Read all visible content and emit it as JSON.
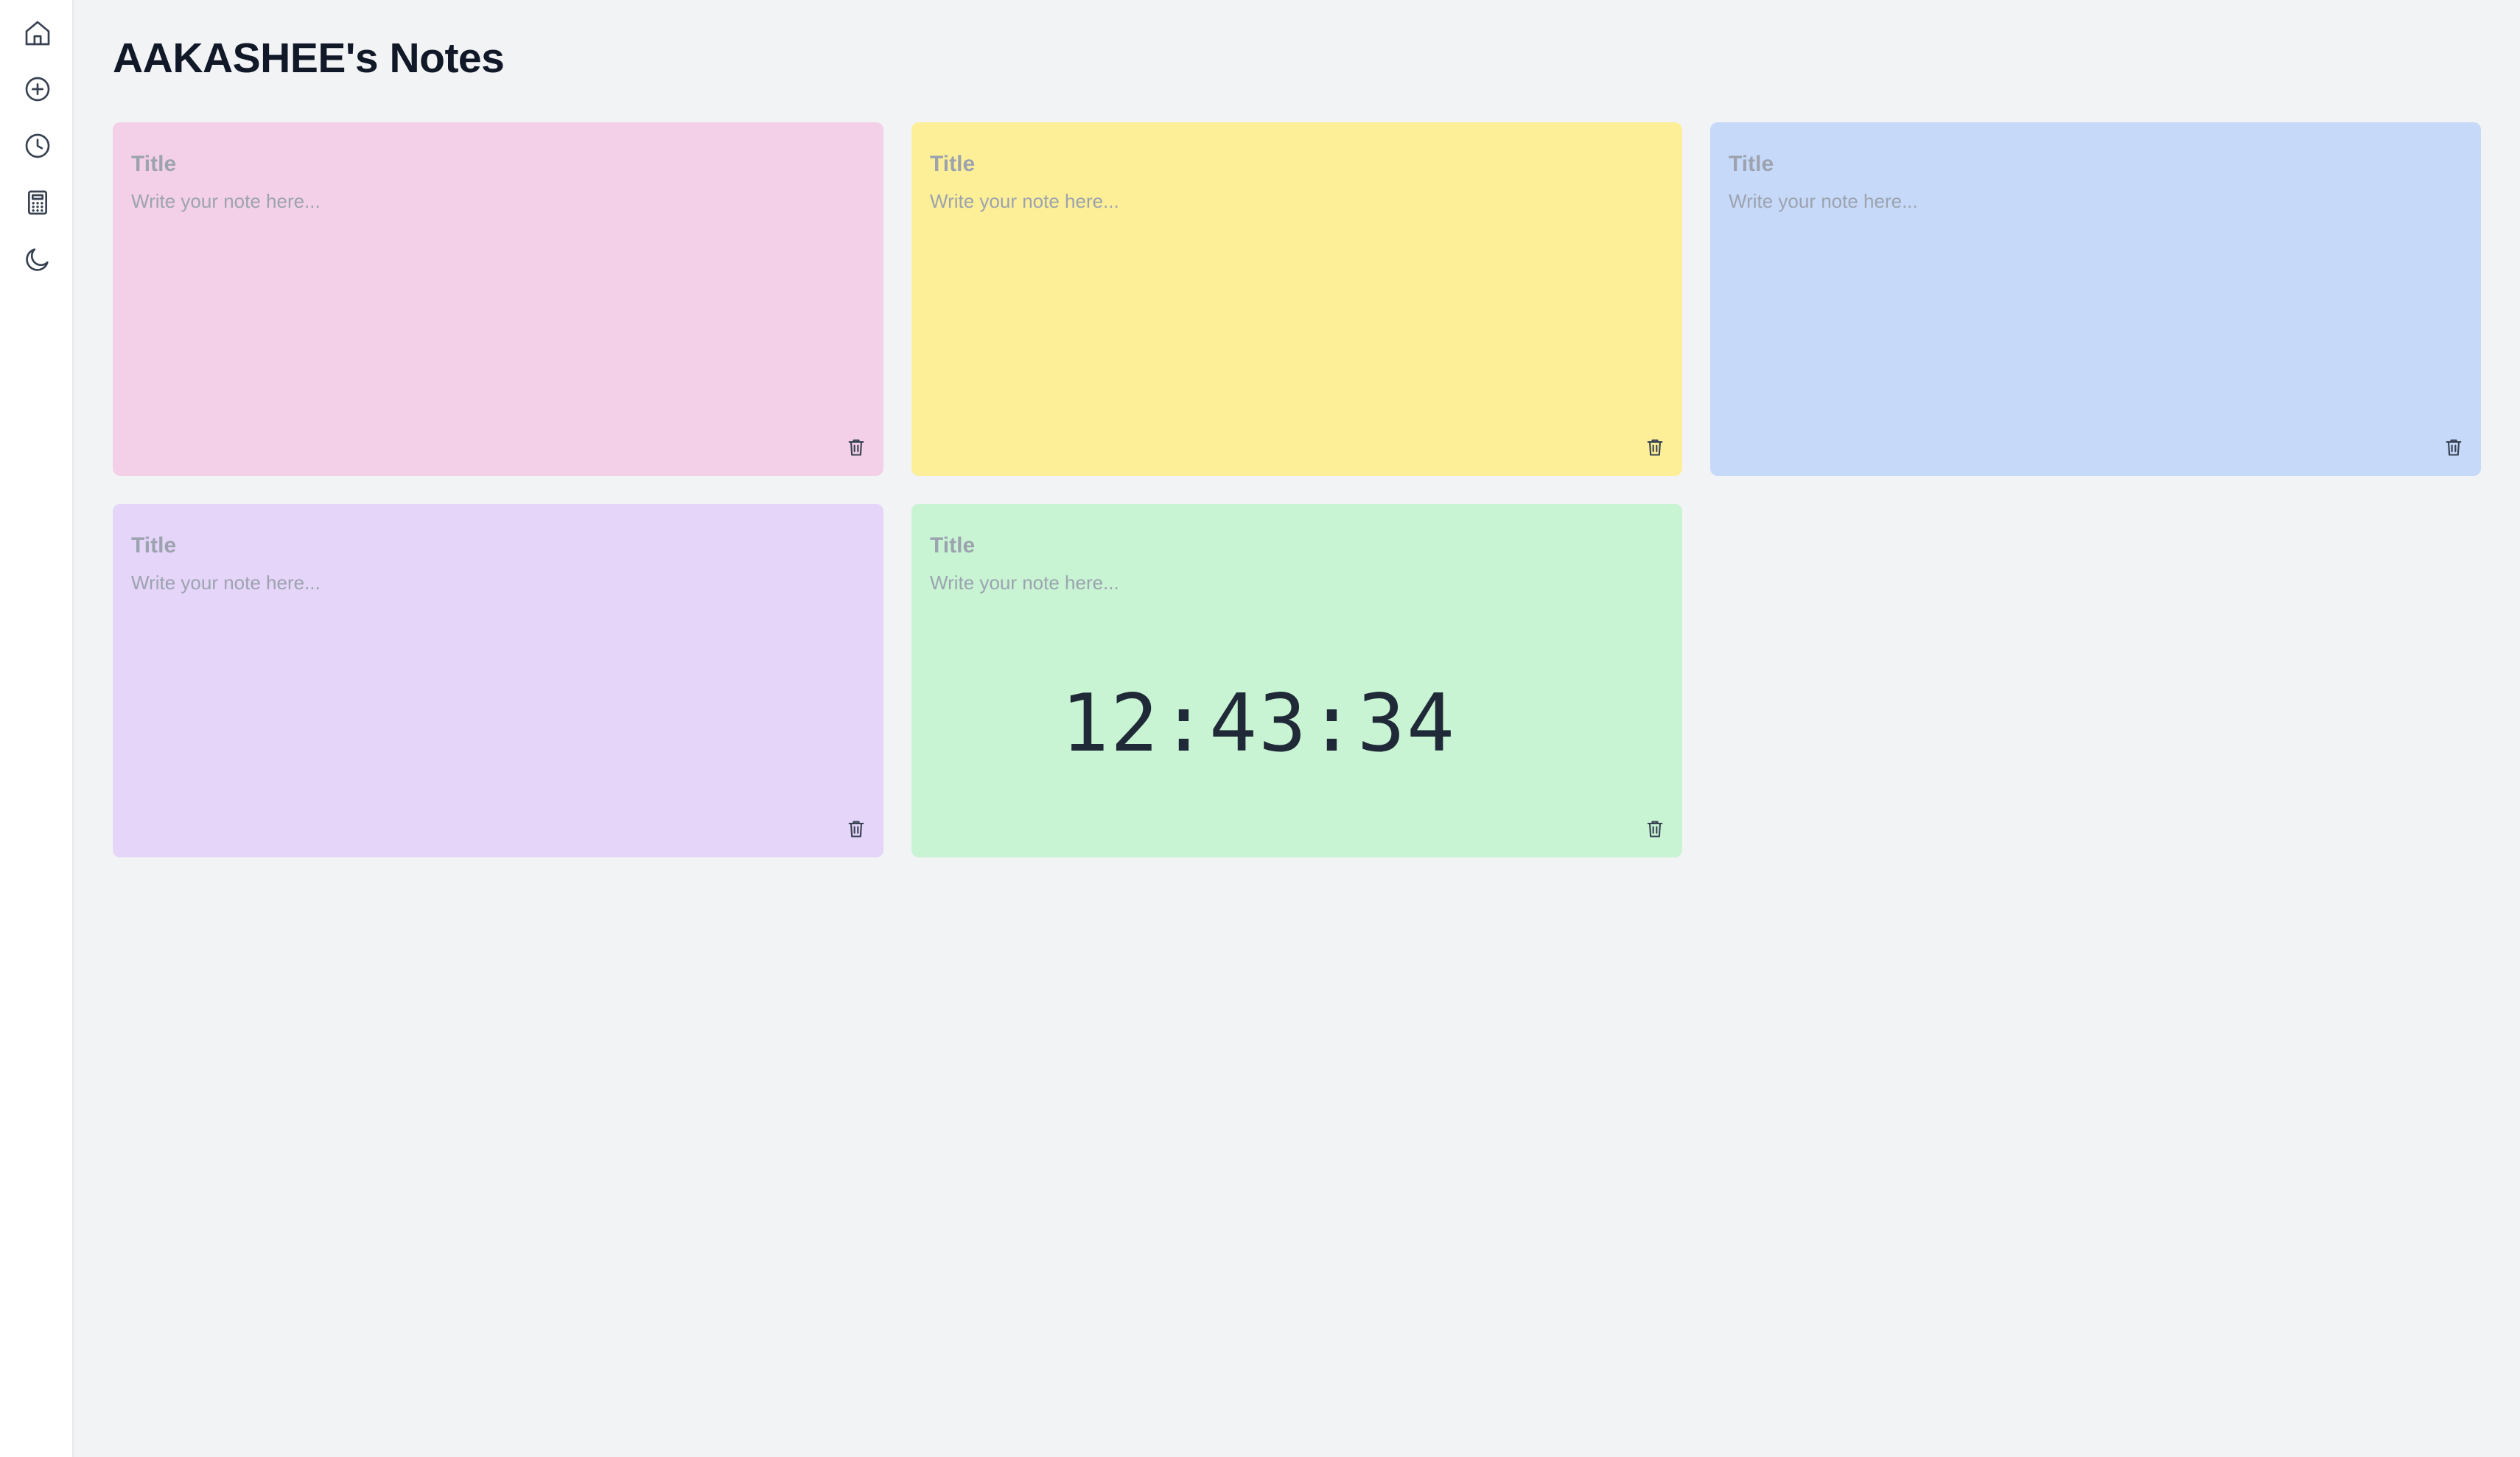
{
  "header": {
    "title": "AAKASHEE's Notes"
  },
  "sidebar": {
    "items": [
      {
        "icon": "home-icon"
      },
      {
        "icon": "plus-circle-icon"
      },
      {
        "icon": "clock-icon"
      },
      {
        "icon": "calculator-icon"
      },
      {
        "icon": "moon-icon"
      }
    ]
  },
  "notes": [
    {
      "title_placeholder": "Title",
      "body_placeholder": "Write your note here...",
      "color": "#f3d0e7"
    },
    {
      "title_placeholder": "Title",
      "body_placeholder": "Write your note here...",
      "color": "#fdef97"
    },
    {
      "title_placeholder": "Title",
      "body_placeholder": "Write your note here...",
      "color": "#c6d9f8"
    },
    {
      "title_placeholder": "Title",
      "body_placeholder": "Write your note here...",
      "color": "#e5d5f9"
    },
    {
      "title_placeholder": "Title",
      "body_placeholder": "Write your note here...",
      "color": "#c8f4d4",
      "clock": "12:43:34"
    }
  ],
  "colors": {
    "background": "#f2f3f5",
    "sidebar": "#ffffff",
    "text": "#111827",
    "placeholder": "#9ca3af"
  }
}
